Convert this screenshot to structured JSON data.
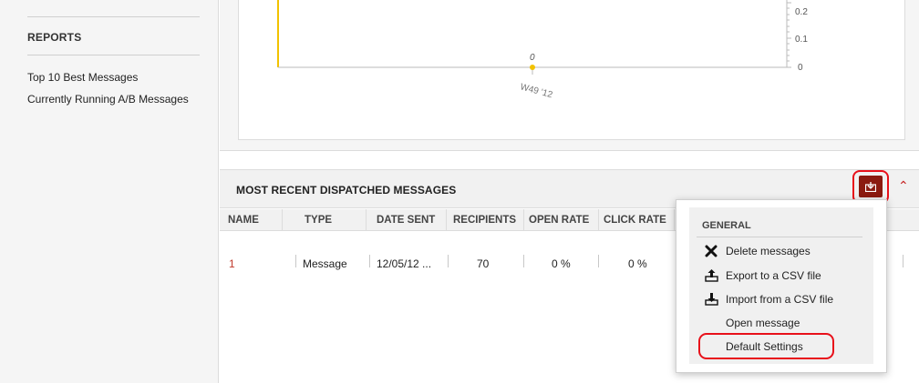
{
  "sidebar": {
    "reports_title": "REPORTS",
    "links": [
      "Top 10 Best Messages",
      "Currently Running A/B Messages"
    ]
  },
  "chart": {
    "y_ticks": [
      "0.2",
      "0.1",
      "0"
    ],
    "point_label": "0",
    "x_tick": "W49 '12",
    "line_color": "#f2c200"
  },
  "messages": {
    "title": "MOST RECENT DISPATCHED MESSAGES",
    "columns": [
      "NAME",
      "TYPE",
      "DATE SENT",
      "RECIPIENTS",
      "OPEN RATE",
      "CLICK RATE"
    ],
    "rows": [
      {
        "name": "1",
        "type": "Message",
        "date_sent": "12/05/12 ...",
        "recipients": "70",
        "open_rate": "0 %",
        "click_rate": "0 %"
      }
    ],
    "accent": "#8b1a0f"
  },
  "menu": {
    "heading": "GENERAL",
    "items": [
      {
        "label": "Delete messages",
        "icon": "x-icon"
      },
      {
        "label": "Export to a CSV file",
        "icon": "export-icon"
      },
      {
        "label": "Import from a CSV file",
        "icon": "import-icon"
      },
      {
        "label": "Open message",
        "icon": ""
      },
      {
        "label": "Default Settings",
        "icon": ""
      }
    ]
  }
}
